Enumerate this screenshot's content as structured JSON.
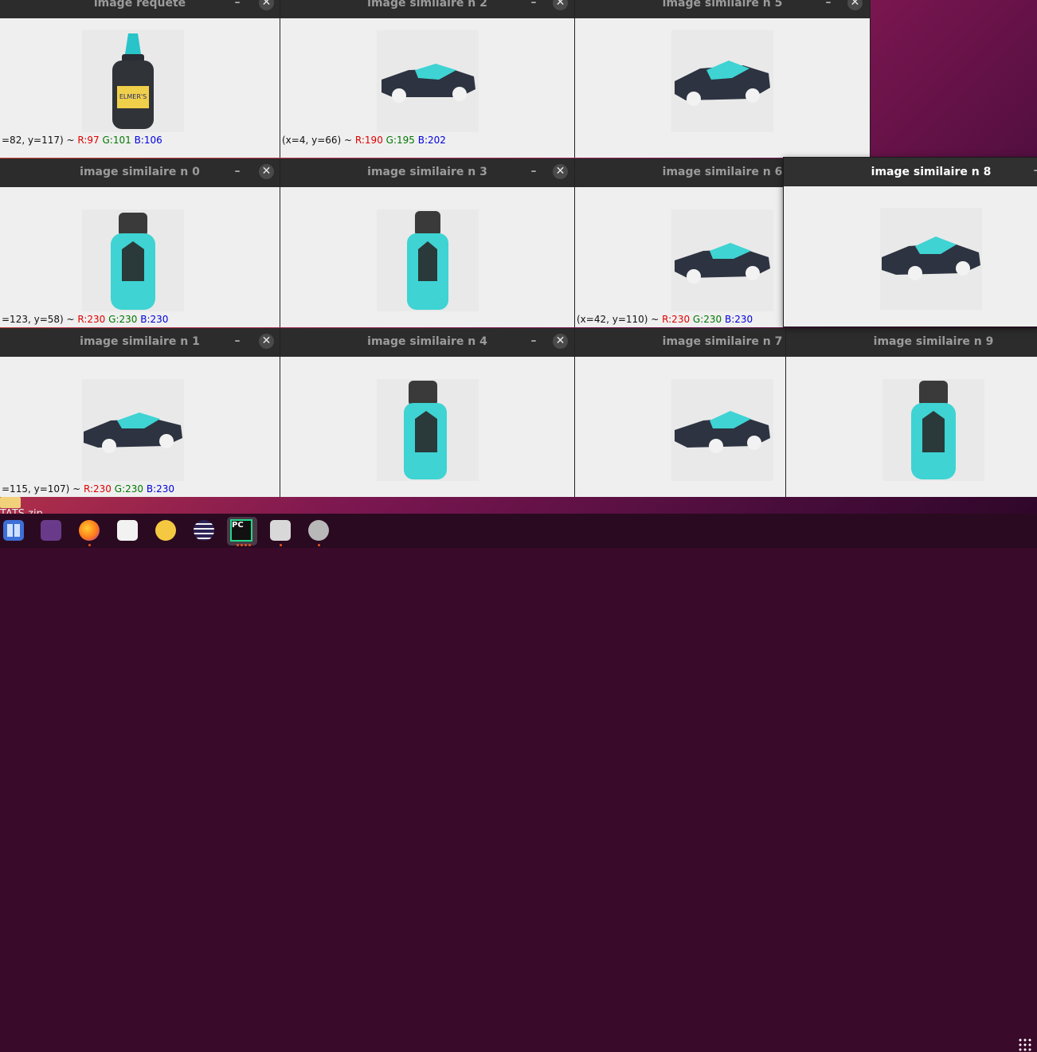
{
  "desktop_file": {
    "label": "TATS.zip"
  },
  "windows": {
    "requete": {
      "title": "image requete",
      "coords": "=82, y=117) ~ ",
      "r": "R:97",
      "g": "G:101",
      "b": "B:106"
    },
    "n0": {
      "title": "image similaire n 0",
      "coords": "=123, y=58) ~ ",
      "r": "R:230",
      "g": "G:230",
      "b": "B:230"
    },
    "n1": {
      "title": "image similaire n 1",
      "coords": "=115, y=107) ~ ",
      "r": "R:230",
      "g": "G:230",
      "b": "B:230"
    },
    "n2": {
      "title": "image similaire n 2",
      "coords": "(x=4, y=66) ~ ",
      "r": "R:190",
      "g": "G:195",
      "b": "B:202"
    },
    "n3": {
      "title": "image similaire n 3"
    },
    "n4": {
      "title": "image similaire n 4"
    },
    "n5": {
      "title": "image similaire n 5"
    },
    "n6": {
      "title": "image similaire n 6",
      "coords": "(x=42, y=110) ~ ",
      "r": "R:230",
      "g": "G:230",
      "b": "B:230"
    },
    "n7": {
      "title": "image similaire n 7"
    },
    "n8": {
      "title": "image similaire n 8"
    },
    "n9": {
      "title": "image similaire n 9"
    }
  },
  "controls": {
    "minimize": "–",
    "close": "✕"
  },
  "taskbar": {
    "icons": [
      "files-icon",
      "screen-recorder-icon",
      "firefox-icon",
      "text-editor-icon",
      "teapot-icon",
      "eclipse-icon",
      "pycharm-icon",
      "image-viewer-icon",
      "disk-icon",
      "show-apps-icon"
    ],
    "pycharm_label": "PC"
  },
  "colors": {
    "titlebar": "#2c2c2c",
    "content": "#efefef",
    "accent": "#e95420",
    "cyan": "#3fd3d3"
  }
}
